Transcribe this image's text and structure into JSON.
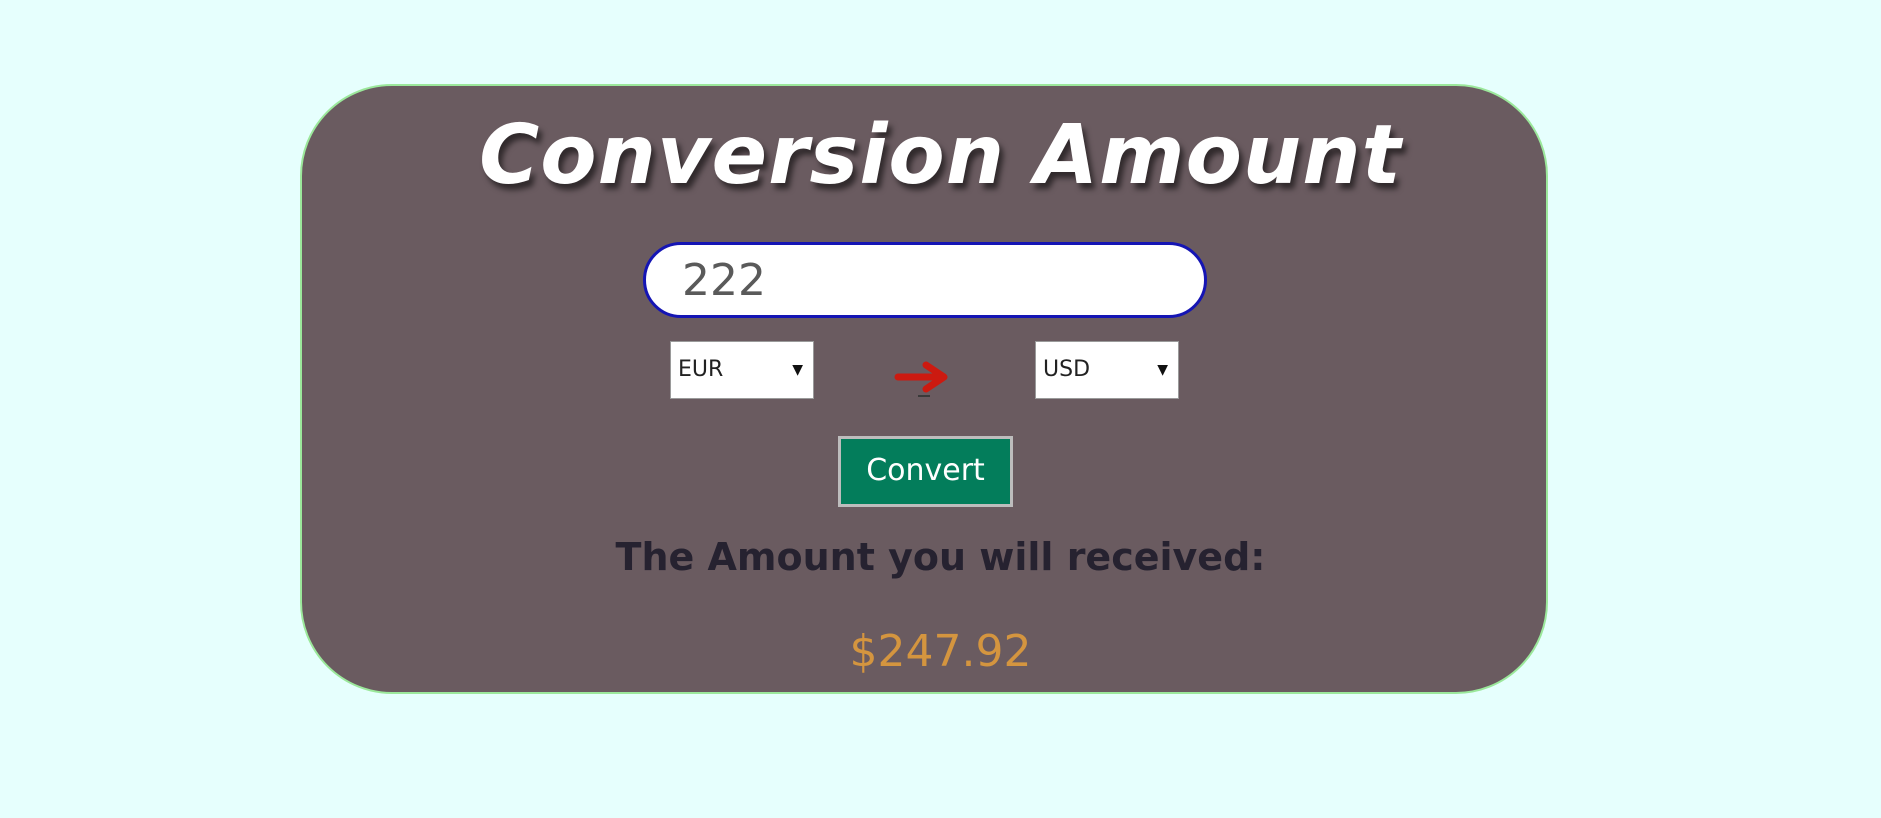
{
  "title": "Conversion Amount",
  "amount_input": {
    "value": "222"
  },
  "from_currency": {
    "selected": "EUR"
  },
  "to_currency": {
    "selected": "USD"
  },
  "swap_indicator": {
    "icon": "right-arrow-icon",
    "color": "#cc1a10"
  },
  "convert_button": {
    "label": "Convert"
  },
  "result": {
    "label": "The Amount you will received:",
    "value": "$247.92"
  },
  "colors": {
    "page_background": "#e6fffd",
    "card_background": "#6a5b60",
    "card_border": "#9be89b",
    "input_border": "#1515b4",
    "button_background": "#037d5b",
    "result_value": "#d4953f"
  }
}
